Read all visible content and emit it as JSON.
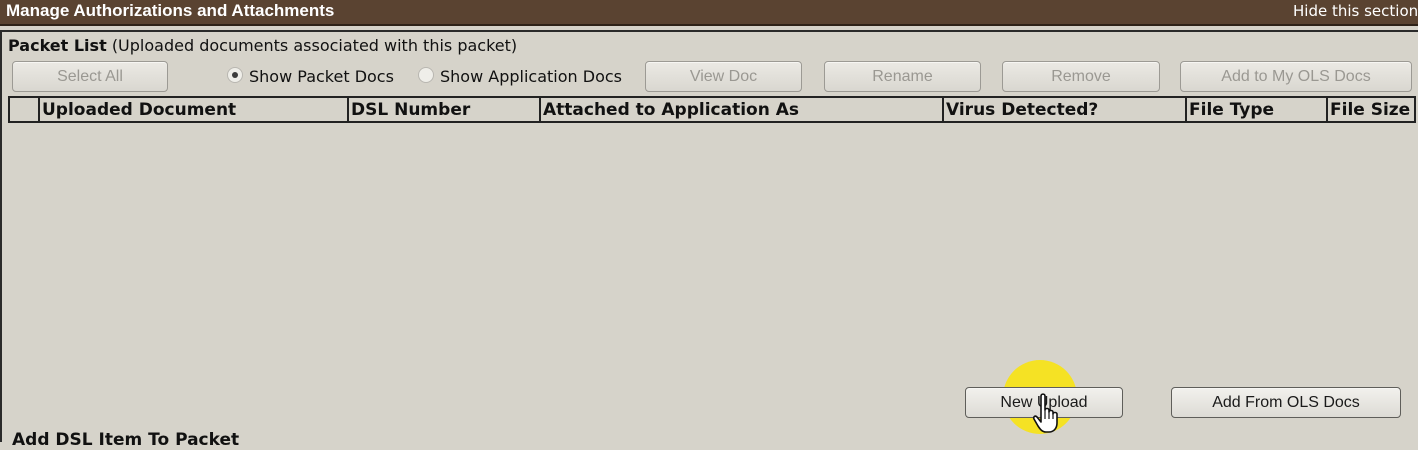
{
  "header": {
    "title": "Manage Authorizations and Attachments",
    "hide_link": "Hide this section"
  },
  "packet_list": {
    "heading": "Packet List",
    "subheading": "(Uploaded documents associated with this packet)"
  },
  "toolbar": {
    "select_all": "Select All",
    "radio_packet": "Show Packet Docs",
    "radio_application": "Show Application Docs",
    "radio_selected": "Show Packet Docs",
    "view_doc": "View Doc",
    "rename": "Rename",
    "remove": "Remove",
    "add_to_ols": "Add to My OLS Docs"
  },
  "grid": {
    "columns": [
      "Uploaded Document",
      "DSL Number",
      "Attached to Application As",
      "Virus Detected?",
      "File Type",
      "File Size"
    ],
    "rows": []
  },
  "actions": {
    "new_upload": "New Upload",
    "add_from_ols": "Add From OLS Docs"
  },
  "next_section": {
    "title": "Add DSL Item To Packet"
  },
  "colors": {
    "header_bg": "#5a4331",
    "panel_bg": "#d6d3ca",
    "click_highlight": "#f7e31a"
  }
}
